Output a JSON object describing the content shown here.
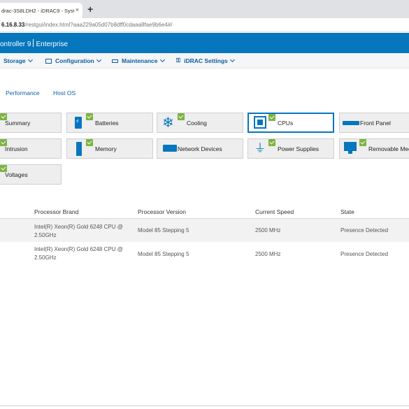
{
  "browser": {
    "tab_title": "drac-3S8LDH2 - iDRAC9 - Syste",
    "tab_close": "×",
    "new_tab": "+",
    "address_host": "6.16.8.33",
    "address_path": "/restgui/index.html?aaa229a05d07b8dff0cdaaa8fae9b6e4#/"
  },
  "app_header": {
    "title_left": "ontroller 9",
    "title_right": "Enterprise"
  },
  "nav": {
    "storage": "Storage",
    "configuration": "Configuration",
    "maintenance": "Maintenance",
    "idrac_settings": "iDRAC Settings"
  },
  "subtabs": {
    "performance": "Performance",
    "host_os": "Host OS"
  },
  "tiles": {
    "summary": "Summary",
    "batteries": "Batteries",
    "cooling": "Cooling",
    "cpus": "CPUs",
    "front_panel": "Front Panel",
    "intrusion": "Intrusion",
    "memory": "Memory",
    "network_devices": "Network Devices",
    "power_supplies": "Power Supplies",
    "removable_media": "Removable Med",
    "voltages": "Voltages"
  },
  "table": {
    "headers": {
      "brand": "Processor Brand",
      "version": "Processor Version",
      "speed": "Current Speed",
      "state": "State"
    },
    "rows": [
      {
        "brand": "Intel(R) Xeon(R) Gold 6248 CPU @ 2.50GHz",
        "version": "Model 85 Stepping 5",
        "speed": "2500 MHz",
        "state": "Presence Detected"
      },
      {
        "brand": "Intel(R) Xeon(R) Gold 6248 CPU @ 2.50GHz",
        "version": "Model 85 Stepping 5",
        "speed": "2500 MHz",
        "state": "Presence Detected"
      }
    ]
  },
  "colors": {
    "brand_blue": "#0676bd",
    "status_ok": "#7cb342",
    "link_blue": "#0b5fa5"
  }
}
